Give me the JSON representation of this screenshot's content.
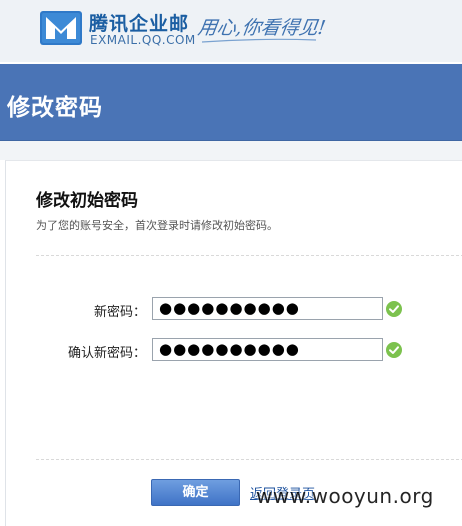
{
  "logo": {
    "name": "腾讯企业邮",
    "domain": "EXMAIL.QQ.COM",
    "slogan": "用心,你看得见!"
  },
  "header": {
    "title": "修改密码"
  },
  "form": {
    "title": "修改初始密码",
    "description": "为了您的账号安全，首次登录时请修改初始密码。",
    "new_password": {
      "label": "新密码：",
      "value": "●●●●●●●●●●",
      "status_icon": "check-icon"
    },
    "confirm_password": {
      "label": "确认新密码：",
      "value": "●●●●●●●●●●",
      "status_icon": "check-icon"
    },
    "confirm_button": "确定",
    "back_link": "返回登录页"
  },
  "watermark": "www.wooyun.org",
  "colors": {
    "header_band": "#4a74b6",
    "button": "#4a7fd0",
    "check": "#7cc24e"
  }
}
